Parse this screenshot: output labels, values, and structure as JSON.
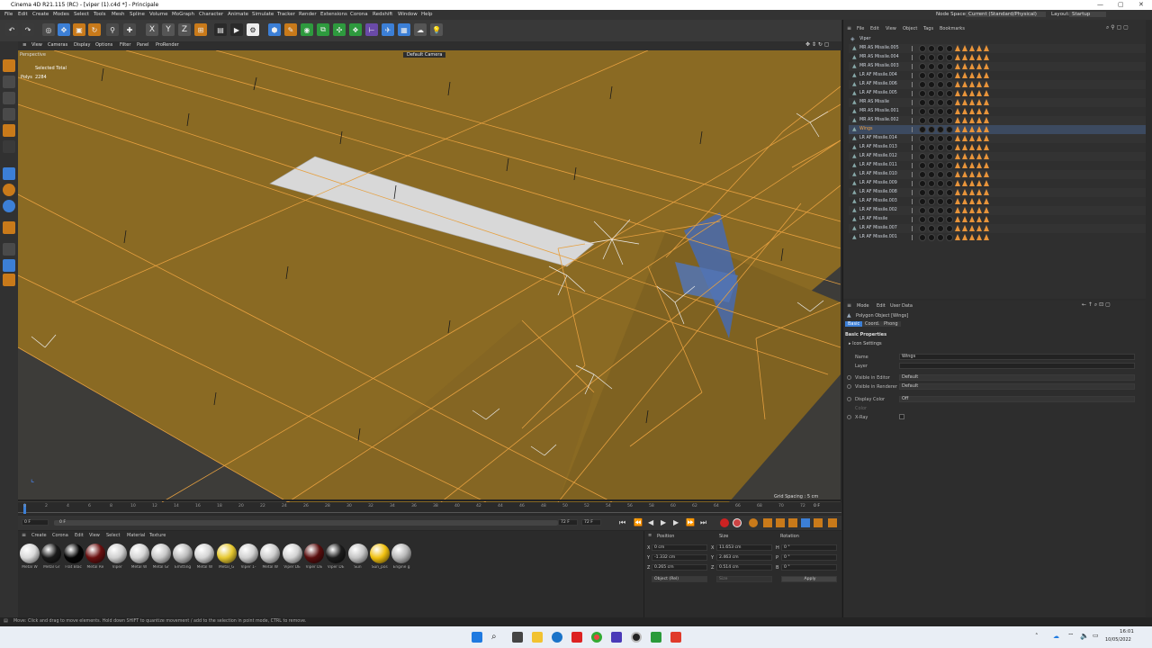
{
  "window": {
    "title": "Cinema 4D R21.115 (RC) - [viper (1).c4d *] - Principale",
    "controls": [
      "—",
      "▢",
      "✕"
    ]
  },
  "menubar": {
    "items": [
      "File",
      "Edit",
      "Create",
      "Modes",
      "Select",
      "Tools",
      "Mesh",
      "Spline",
      "Volume",
      "MoGraph",
      "Character",
      "Animate",
      "Simulate",
      "Tracker",
      "Render",
      "Extensions",
      "Corona",
      "Redshift",
      "Window",
      "Help"
    ],
    "node_space_label": "Node Space:",
    "node_space_value": "Current (Standard/Physical)",
    "layout_label": "Layout:",
    "layout_value": "Startup"
  },
  "viewport_menu": [
    "View",
    "Cameras",
    "Display",
    "Options",
    "Filter",
    "Panel",
    "ProRender"
  ],
  "viewport": {
    "label": "Perspective",
    "camera": "Default Camera",
    "selected_total": "Selected Total",
    "polys_label": "Polys",
    "polys_value": "2284",
    "grid_spacing": "Grid Spacing : 5 cm"
  },
  "timeline": {
    "ticks": [
      "0",
      "2",
      "4",
      "6",
      "8",
      "10",
      "12",
      "14",
      "16",
      "18",
      "20",
      "22",
      "24",
      "26",
      "28",
      "30",
      "32",
      "34",
      "36",
      "38",
      "40",
      "42",
      "44",
      "46",
      "48",
      "50",
      "52",
      "54",
      "56",
      "58",
      "60",
      "62",
      "64",
      "66",
      "68",
      "70",
      "72"
    ],
    "current_frame": "0 F",
    "start_frame": "0 F",
    "range_start": "0 F",
    "end_frame": "72 F",
    "end_frame2": "72 F"
  },
  "material_panel": {
    "menu": [
      "Create",
      "Corona",
      "Edit",
      "View",
      "Select",
      "Material",
      "Texture"
    ],
    "materials": [
      {
        "label": "Metal W",
        "color": "#d9d9d9"
      },
      {
        "label": "Metal Gr",
        "color": "#1a1a1a"
      },
      {
        "label": "Flat Blac",
        "color": "#050505"
      },
      {
        "label": "Metal Re",
        "color": "#6a1010"
      },
      {
        "label": "Viper",
        "color": "#cfcfcf"
      },
      {
        "label": "Metal W",
        "color": "#d5d5d5"
      },
      {
        "label": "Metal Gr",
        "color": "#c8c8c8"
      },
      {
        "label": "Emitting",
        "color": "#bdbdbd"
      },
      {
        "label": "Metal W",
        "color": "#d4d4d4"
      },
      {
        "label": "Metal_G",
        "color": "#e6c830"
      },
      {
        "label": "Viper 1-",
        "color": "#d0d0d0"
      },
      {
        "label": "Metal W",
        "color": "#cdcdcd"
      },
      {
        "label": "Viper DE",
        "color": "#d3d3d3"
      },
      {
        "label": "Viper DE",
        "color": "#5a0e0e"
      },
      {
        "label": "Viper DE",
        "color": "#1c1c1c"
      },
      {
        "label": "Sun",
        "color": "#c4c4c4"
      },
      {
        "label": "Sun_pos",
        "color": "#f0c010"
      },
      {
        "label": "Engine g",
        "color": "#b8b8b8"
      }
    ]
  },
  "coords": {
    "headers": [
      "Position",
      "Size",
      "Rotation"
    ],
    "rows": [
      {
        "axis": "X",
        "pos": "0 cm",
        "size_axis": "X",
        "size": "11.653 cm",
        "rot_axis": "H",
        "rot": "0 °"
      },
      {
        "axis": "Y",
        "pos": "-1.332 cm",
        "size_axis": "Y",
        "size": "2.463 cm",
        "rot_axis": "P",
        "rot": "0 °"
      },
      {
        "axis": "Z",
        "pos": "0.265 cm",
        "size_axis": "Z",
        "size": "0.514 cm",
        "rot_axis": "B",
        "rot": "0 °"
      }
    ],
    "mode": "Object (Rel)",
    "size_mode": "Size",
    "apply": "Apply"
  },
  "object_manager": {
    "menu": [
      "File",
      "Edit",
      "View",
      "Object",
      "Tags",
      "Bookmarks"
    ],
    "root": "Viper",
    "objects": [
      "MR AS Missile.005",
      "MR AS Missile.004",
      "MR AS Missile.003",
      "LR AF Missile.004",
      "LR AF Missile.006",
      "LR AF Missile.005",
      "MR AS Missile",
      "MR AS Missile.001",
      "MR AS Missile.002",
      "Wings",
      "LR AF Missile.014",
      "LR AF Missile.013",
      "LR AF Missile.012",
      "LR AF Missile.011",
      "LR AF Missile.010",
      "LR AF Missile.009",
      "LR AF Missile.008",
      "LR AF Missile.003",
      "LR AF Missile.002",
      "LR AF Missile",
      "LR AF Missile.007",
      "LR AF Missile.001"
    ],
    "selected": "Wings"
  },
  "attributes": {
    "menu": [
      "Mode",
      "Edit",
      "User Data"
    ],
    "object_title": "Polygon Object [Wings]",
    "tabs": [
      "Basic",
      "Coord.",
      "Phong"
    ],
    "section": "Basic Properties",
    "icon_settings": "▸ Icon Settings",
    "fields": [
      {
        "label": "Name",
        "value": "Wings"
      },
      {
        "label": "Layer",
        "value": ""
      },
      {
        "label": "Visible in Editor",
        "value": "Default"
      },
      {
        "label": "Visible in Renderer",
        "value": "Default"
      },
      {
        "label": "Display Color",
        "value": "Off"
      },
      {
        "label": "Color",
        "value": ""
      },
      {
        "label": "X-Ray",
        "value": ""
      }
    ]
  },
  "statusbar": {
    "text": "Move: Click and drag to move elements. Hold down SHIFT to quantize movement / add to the selection in point mode, CTRL to remove."
  },
  "taskbar": {
    "time": "16:01",
    "date": "10/05/2022"
  },
  "colors": {
    "mesh_fill": "#8a6a23",
    "wire": "#e6a040",
    "selected_poly": "#d8d8d8",
    "blue_poly": "#4a6aa8",
    "accent": "#3c7fd6"
  }
}
